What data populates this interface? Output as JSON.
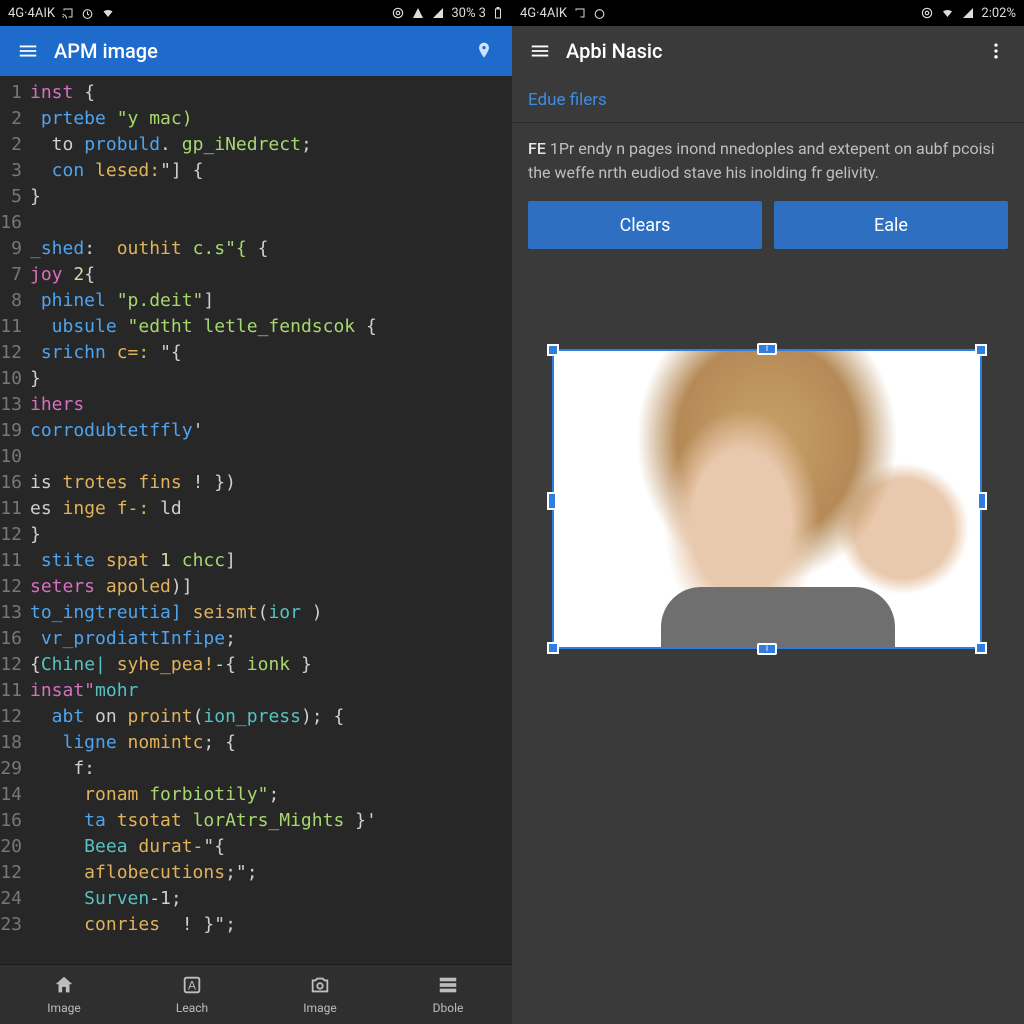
{
  "left": {
    "status": {
      "net": "4G·4AIK",
      "battery": "30% 3"
    },
    "appbar": {
      "title": "APM image"
    },
    "code": [
      {
        "n": "1",
        "tokens": [
          [
            "kw",
            "inst"
          ],
          [
            "punc",
            " {"
          ]
        ]
      },
      {
        "n": "2",
        "tokens": [
          [
            "fn",
            " prtebe "
          ],
          [
            "str",
            "\"y mac)"
          ]
        ]
      },
      {
        "n": "2",
        "tokens": [
          [
            "punc",
            "  to "
          ],
          [
            "fn",
            "probuld"
          ],
          [
            "punc",
            ". "
          ],
          [
            "str",
            "gp_iNedrect"
          ],
          [
            "punc",
            ";"
          ]
        ]
      },
      {
        "n": "3",
        "tokens": [
          [
            "fn",
            "  con "
          ],
          [
            "id",
            "lesed:"
          ],
          [
            "punc",
            "\"] {"
          ]
        ]
      },
      {
        "n": "5",
        "tokens": [
          [
            "punc",
            "}"
          ]
        ]
      },
      {
        "n": "16",
        "tokens": [
          [
            "punc",
            " "
          ]
        ]
      },
      {
        "n": "9",
        "tokens": [
          [
            "fn",
            "_shed"
          ],
          [
            "punc",
            ":  "
          ],
          [
            "id",
            "outhit "
          ],
          [
            "str",
            "c.s\"{"
          ],
          [
            "punc",
            " {"
          ]
        ]
      },
      {
        "n": "7",
        "tokens": [
          [
            "kw",
            "joy "
          ],
          [
            "num",
            "2"
          ],
          [
            "punc",
            "{"
          ]
        ]
      },
      {
        "n": "8",
        "tokens": [
          [
            "fn",
            " phinel "
          ],
          [
            "str",
            "\"p.deit\""
          ],
          [
            "punc",
            "]"
          ]
        ]
      },
      {
        "n": "11",
        "tokens": [
          [
            "fn",
            "  ubsule "
          ],
          [
            "str",
            "\"edtht letle_fendscok"
          ],
          [
            "punc",
            " {"
          ]
        ]
      },
      {
        "n": "12",
        "tokens": [
          [
            "fn",
            " srichn "
          ],
          [
            "id",
            "c=: "
          ],
          [
            "punc",
            "\"{"
          ]
        ]
      },
      {
        "n": "10",
        "tokens": [
          [
            "punc",
            "}"
          ]
        ]
      },
      {
        "n": "13",
        "tokens": [
          [
            "kw",
            "ihers"
          ]
        ]
      },
      {
        "n": "19",
        "tokens": [
          [
            "fn",
            "corrodubtetffly"
          ],
          [
            "punc",
            "'"
          ]
        ]
      },
      {
        "n": "10",
        "tokens": [
          [
            "punc",
            " "
          ]
        ]
      },
      {
        "n": "16",
        "tokens": [
          [
            "punc",
            "is "
          ],
          [
            "id",
            "trotes fins "
          ],
          [
            "punc",
            "! })"
          ]
        ]
      },
      {
        "n": "11",
        "tokens": [
          [
            "punc",
            "es "
          ],
          [
            "id",
            "inge f-: "
          ],
          [
            "punc",
            "ld"
          ]
        ]
      },
      {
        "n": "12",
        "tokens": [
          [
            "punc",
            "}"
          ]
        ]
      },
      {
        "n": "11",
        "tokens": [
          [
            "fn",
            " stite "
          ],
          [
            "id",
            "spat "
          ],
          [
            "num",
            "1 "
          ],
          [
            "str",
            "chcc"
          ],
          [
            "punc",
            "]"
          ]
        ]
      },
      {
        "n": "12",
        "tokens": [
          [
            "kw",
            "seters "
          ],
          [
            "id",
            "apoled"
          ],
          [
            "punc",
            ")]"
          ]
        ]
      },
      {
        "n": "13",
        "tokens": [
          [
            "fn",
            "to_ingtreutia] "
          ],
          [
            "id",
            "seismt"
          ],
          [
            "punc",
            "("
          ],
          [
            "type",
            "ior"
          ],
          [
            "punc",
            " )"
          ]
        ]
      },
      {
        "n": "16",
        "tokens": [
          [
            "fn",
            " vr_prodiattInfipe"
          ],
          [
            "punc",
            ";"
          ]
        ]
      },
      {
        "n": "12",
        "tokens": [
          [
            "punc",
            "{"
          ],
          [
            "type",
            "Chine| "
          ],
          [
            "id",
            "syhe_pea!"
          ],
          [
            "punc",
            "-{ "
          ],
          [
            "str",
            "ionk"
          ],
          [
            "punc",
            " }"
          ]
        ]
      },
      {
        "n": "11",
        "tokens": [
          [
            "kw",
            "insat\""
          ],
          [
            "type",
            "mohr"
          ]
        ]
      },
      {
        "n": "12",
        "tokens": [
          [
            "fn",
            "  abt "
          ],
          [
            "punc",
            "on "
          ],
          [
            "id",
            "proint"
          ],
          [
            "punc",
            "("
          ],
          [
            "type",
            "ion_press"
          ],
          [
            "punc",
            "); {"
          ]
        ]
      },
      {
        "n": "18",
        "tokens": [
          [
            "fn",
            "   ligne "
          ],
          [
            "id",
            "nomintc"
          ],
          [
            "punc",
            "; {"
          ]
        ]
      },
      {
        "n": "29",
        "tokens": [
          [
            "punc",
            "    f:"
          ]
        ]
      },
      {
        "n": "14",
        "tokens": [
          [
            "id",
            "     ronam "
          ],
          [
            "str",
            "forbiotily\""
          ],
          [
            "punc",
            ";"
          ]
        ]
      },
      {
        "n": "16",
        "tokens": [
          [
            "fn",
            "     ta "
          ],
          [
            "id",
            "tsotat "
          ],
          [
            "str",
            "lorAtrs_Mights "
          ],
          [
            "punc",
            "}'"
          ]
        ]
      },
      {
        "n": "20",
        "tokens": [
          [
            "type",
            "     Beea "
          ],
          [
            "id",
            "durat-"
          ],
          [
            "punc",
            "\"{"
          ]
        ]
      },
      {
        "n": "12",
        "tokens": [
          [
            "id",
            "     aflobecutions"
          ],
          [
            "punc",
            ";\";"
          ]
        ]
      },
      {
        "n": "24",
        "tokens": [
          [
            "type",
            "     Surven"
          ],
          [
            "punc",
            "-1;"
          ]
        ]
      },
      {
        "n": "23",
        "tokens": [
          [
            "id",
            "     conries"
          ],
          [
            "punc",
            "  ! }\";"
          ]
        ]
      }
    ],
    "bottomnav": [
      {
        "label": "Image",
        "icon": "home-icon"
      },
      {
        "label": "Leach",
        "icon": "font-icon"
      },
      {
        "label": "Image",
        "icon": "camera-icon"
      },
      {
        "label": "Dbole",
        "icon": "grid-icon"
      }
    ]
  },
  "right": {
    "status": {
      "net": "4G·4AIK",
      "time": "2:02%"
    },
    "appbar": {
      "title": "Apbi Nasic"
    },
    "section_label": "Edue filers",
    "desc_lead": "FE",
    "desc_body": " 1Pr endy n pages inond nnedoples and extepent on aubf pcoisi the weffe nrth eudiod stave his inolding fr gelivity.",
    "buttons": {
      "clear": "Clears",
      "apply": "Eale"
    }
  }
}
